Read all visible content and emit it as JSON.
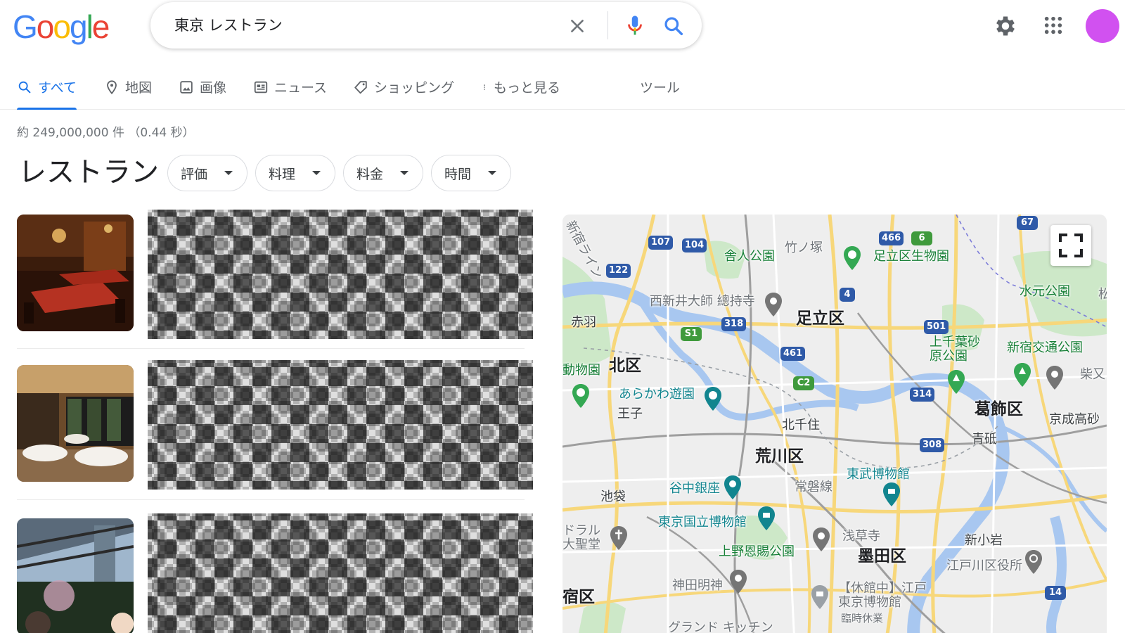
{
  "logo": {
    "letters": [
      "G",
      "o",
      "o",
      "g",
      "l",
      "e"
    ],
    "colors": [
      "#4285f4",
      "#ea4335",
      "#fbbc05",
      "#4285f4",
      "#34a853",
      "#ea4335"
    ]
  },
  "search": {
    "query": "東京 レストラン"
  },
  "tabs": [
    {
      "label": "すべて",
      "icon": "search-icon",
      "active": true
    },
    {
      "label": "地図",
      "icon": "map-pin-icon"
    },
    {
      "label": "画像",
      "icon": "image-icon"
    },
    {
      "label": "ニュース",
      "icon": "news-icon"
    },
    {
      "label": "ショッピング",
      "icon": "tag-icon"
    },
    {
      "label": "もっと見る",
      "icon": "more-vert-icon"
    },
    {
      "label": "ツール"
    }
  ],
  "stats": "約 249,000,000 件 （0.44 秒）",
  "restaurants": {
    "title": "レストラン",
    "filters": [
      "評価",
      "料理",
      "料金",
      "時間"
    ]
  },
  "map": {
    "areas": [
      "足立区",
      "北区",
      "荒川区",
      "葛飾区",
      "墨田区",
      "宿区"
    ],
    "parks": [
      "舎人公園",
      "足立区生物園",
      "水元公園",
      "上千葉砂原公園",
      "新宿交通公園",
      "動物園",
      "上野恩賜公園",
      "あらかわ遊園"
    ],
    "places": [
      "竹ノ塚",
      "西新井大師 總持寺",
      "赤羽",
      "王子",
      "北千住",
      "青砥",
      "京成高砂",
      "谷中銀座",
      "常磐線",
      "東京国立博物館",
      "浅草寺",
      "東武博物館",
      "新小岩",
      "江戸川区役所",
      "神田明神",
      "池袋",
      "ドラル大聖堂",
      "【休館中】江戸東京博物館",
      "臨時休業",
      "グランド キッチン",
      "新宿ライン",
      "柴又",
      "松"
    ],
    "route_shields": [
      "107",
      "104",
      "122",
      "466",
      "6",
      "67",
      "4",
      "318",
      "501",
      "461",
      "S1",
      "C2",
      "314",
      "308",
      "14"
    ]
  }
}
